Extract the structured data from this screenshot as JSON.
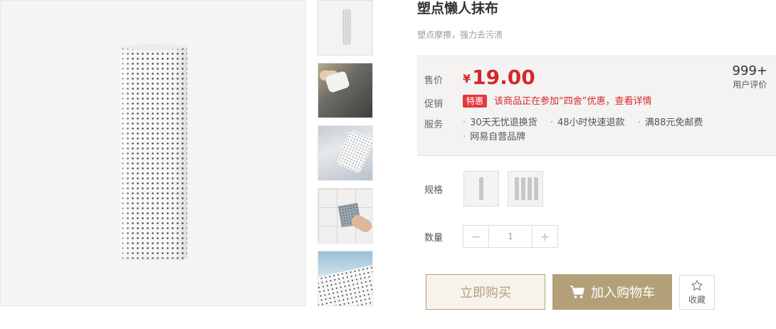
{
  "product": {
    "title": "塑点懒人抹布",
    "subtitle": "塑点摩擦，强力去污渍"
  },
  "images": {
    "main_alt": "dotted-roll-product-image",
    "thumbnails": [
      "roll",
      "wiping-sink",
      "folded-cloth",
      "wiping-tile",
      "dotted-sheet"
    ]
  },
  "price_panel": {
    "price_label": "售价",
    "currency": "¥",
    "price": "19.00",
    "promo_label": "促销",
    "promo_badge": "特惠",
    "promo_text": "该商品正在参加“四舍”优惠，查看详情",
    "service_label": "服务",
    "services": [
      "30天无忧退换货",
      "48小时快速退款",
      "满88元免邮费",
      "网易自营品牌"
    ],
    "review_count": "999+",
    "review_label": "用户评价"
  },
  "spec": {
    "label": "规格",
    "options": [
      "single-roll",
      "four-rolls"
    ]
  },
  "quantity": {
    "label": "数量",
    "value": "1",
    "minus": "−",
    "plus": "+"
  },
  "actions": {
    "buy_now": "立即购买",
    "add_to_cart": "加入购物车",
    "favorite": "收藏"
  },
  "colors": {
    "accent": "#b4a078",
    "price_red": "#d4282d",
    "badge_red": "#e4393c"
  }
}
